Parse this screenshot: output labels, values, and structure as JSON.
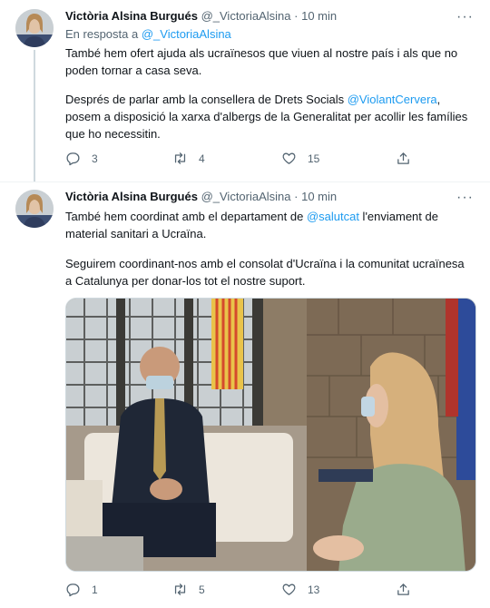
{
  "tweets": [
    {
      "author_name": "Victòria Alsina Burgués",
      "author_handle": "@_VictoriaAlsina",
      "separator": "·",
      "time": "10 min",
      "more": "···",
      "replying_prefix": "En resposta a",
      "replying_to": "@_VictoriaAlsina",
      "paragraph1": "També hem ofert ajuda als ucraïnesos que viuen al nostre país i als que no poden tornar a casa seva.",
      "paragraph2_a": "Després de parlar amb la consellera de Drets Socials ",
      "paragraph2_mention": "@ViolantCervera",
      "paragraph2_b": ", posem a disposició la xarxa d'albergs de la Generalitat per acollir les famílies que ho necessitin.",
      "replies": "3",
      "retweets": "4",
      "likes": "15"
    },
    {
      "author_name": "Victòria Alsina Burgués",
      "author_handle": "@_VictoriaAlsina",
      "separator": "·",
      "time": "10 min",
      "more": "···",
      "paragraph1_a": "També hem coordinat amb el departament de ",
      "paragraph1_mention": "@salutcat",
      "paragraph1_b": " l'enviament de material sanitari a Ucraïna.",
      "paragraph2": "Seguirem coordinant-nos amb el consolat d'Ucraïna i la comunitat ucraïnesa a Catalunya per donar-los tot el nostre suport.",
      "replies": "1",
      "retweets": "5",
      "likes": "13"
    }
  ],
  "colors": {
    "link": "#1d9bf0",
    "muted": "#536471",
    "text": "#0f1419",
    "divider": "#eff3f4"
  },
  "icons": [
    "reply-icon",
    "retweet-icon",
    "like-icon",
    "share-icon",
    "more-icon"
  ]
}
